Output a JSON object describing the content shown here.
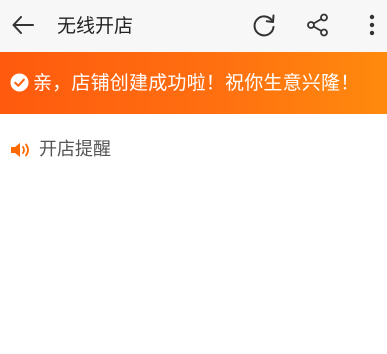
{
  "header": {
    "title": "无线开店",
    "icons": {
      "back": "arrow-left-icon",
      "refresh": "refresh-icon",
      "share": "share-icon",
      "more": "more-vertical-icon"
    }
  },
  "banner": {
    "message": "亲，店铺创建成功啦！祝你生意兴隆！",
    "icon": "check-circle-icon"
  },
  "notice": {
    "label": "开店提醒",
    "icon": "speaker-icon"
  },
  "colors": {
    "banner_start": "#ff5a0e",
    "banner_end": "#ff8a0d",
    "accent": "#ff6a00",
    "topbar_bg": "#f7f7f7"
  }
}
